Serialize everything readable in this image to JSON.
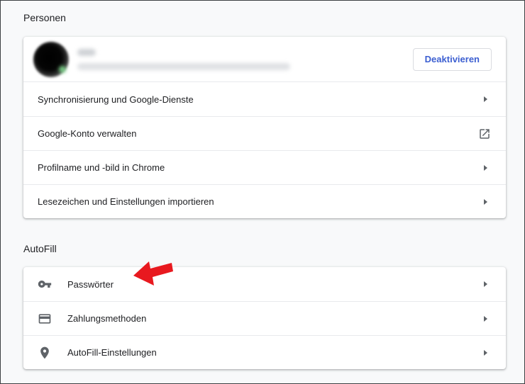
{
  "personen": {
    "title": "Personen",
    "deactivate_label": "Deaktivieren",
    "items": [
      {
        "label": "Synchronisierung und Google-Dienste",
        "icon": "arrow-right-icon"
      },
      {
        "label": "Google-Konto verwalten",
        "icon": "open-in-new-icon"
      },
      {
        "label": "Profilname und -bild in Chrome",
        "icon": "arrow-right-icon"
      },
      {
        "label": "Lesezeichen und Einstellungen importieren",
        "icon": "arrow-right-icon"
      }
    ]
  },
  "autofill": {
    "title": "AutoFill",
    "items": [
      {
        "label": "Passwörter",
        "icon": "key-icon"
      },
      {
        "label": "Zahlungsmethoden",
        "icon": "credit-card-icon"
      },
      {
        "label": "AutoFill-Einstellungen",
        "icon": "location-pin-icon"
      }
    ]
  },
  "colors": {
    "accent": "#3c5fd1",
    "annotation_arrow": "#e8191f",
    "icon": "#5f6368"
  }
}
